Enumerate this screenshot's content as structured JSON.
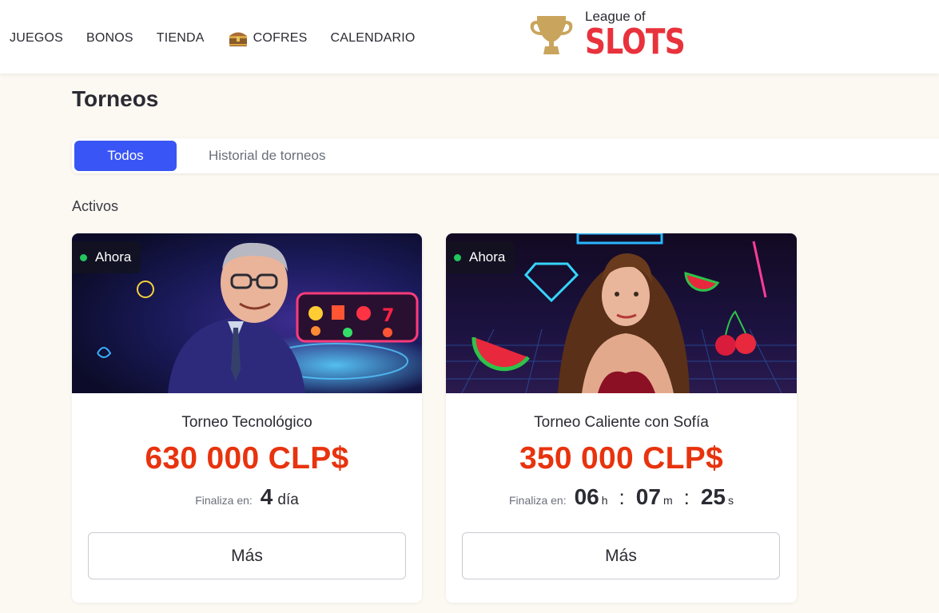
{
  "nav": {
    "items": [
      {
        "label": "JUEGOS"
      },
      {
        "label": "BONOS"
      },
      {
        "label": "TIENDA"
      },
      {
        "label": "COFRES"
      },
      {
        "label": "CALENDARIO"
      }
    ]
  },
  "logo": {
    "top": "League of",
    "main": "SLOTS"
  },
  "page": {
    "title": "Torneos"
  },
  "tabs": [
    {
      "label": "Todos",
      "active": true
    },
    {
      "label": "Historial de torneos",
      "active": false
    }
  ],
  "section": {
    "label": "Activos"
  },
  "colors": {
    "accent": "#3a55f5",
    "prize": "#e8330e",
    "brand": "#e8323c",
    "live": "#22c55e"
  },
  "cards": [
    {
      "badge": "Ahora",
      "name": "Torneo Tecnológico",
      "prize": "630 000 CLP$",
      "ends_label": "Finaliza en:",
      "days": "4",
      "days_unit": "día",
      "button": "Más"
    },
    {
      "badge": "Ahora",
      "name": "Torneo Caliente con Sofía",
      "prize": "350 000 CLP$",
      "ends_label": "Finaliza en:",
      "hours": "06",
      "hours_unit": "h",
      "minutes": "07",
      "minutes_unit": "m",
      "seconds": "25",
      "seconds_unit": "s",
      "button": "Más"
    }
  ]
}
